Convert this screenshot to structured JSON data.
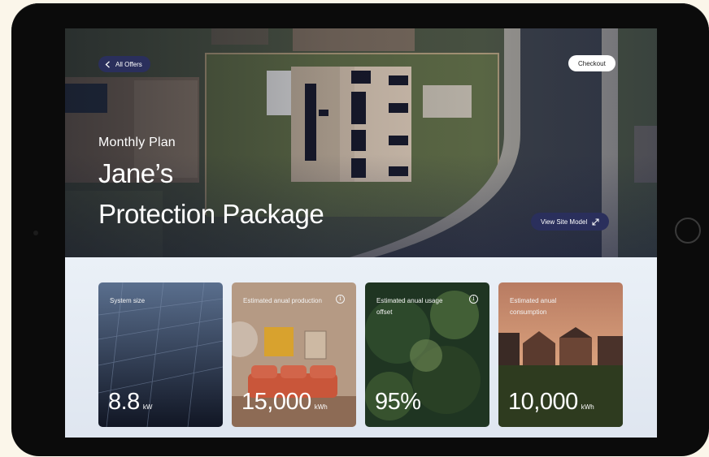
{
  "nav": {
    "back_label": "All Offers",
    "back_icon": "chevron-left-icon",
    "checkout_label": "Checkout",
    "site_model_label": "View Site Model",
    "site_model_icon": "expand-arrows-icon"
  },
  "hero": {
    "plan_label": "Monthly Plan",
    "name": "Jane’s",
    "package": "Protection Package"
  },
  "stats": [
    {
      "label": "System size",
      "value": "8.8",
      "unit": "kW",
      "info": false
    },
    {
      "label": "Estimated anual production",
      "value": "15,000",
      "unit": "kWh",
      "info": true
    },
    {
      "label": "Estimated anual usage offset",
      "value": "95%",
      "unit": "",
      "info": true
    },
    {
      "label": "Estimated anual consumption",
      "value": "10,000",
      "unit": "kWh",
      "info": false
    }
  ],
  "colors": {
    "navy_pill": "#2a2f5c",
    "background": "#fbf6ea",
    "device": "#0b0b0b"
  }
}
